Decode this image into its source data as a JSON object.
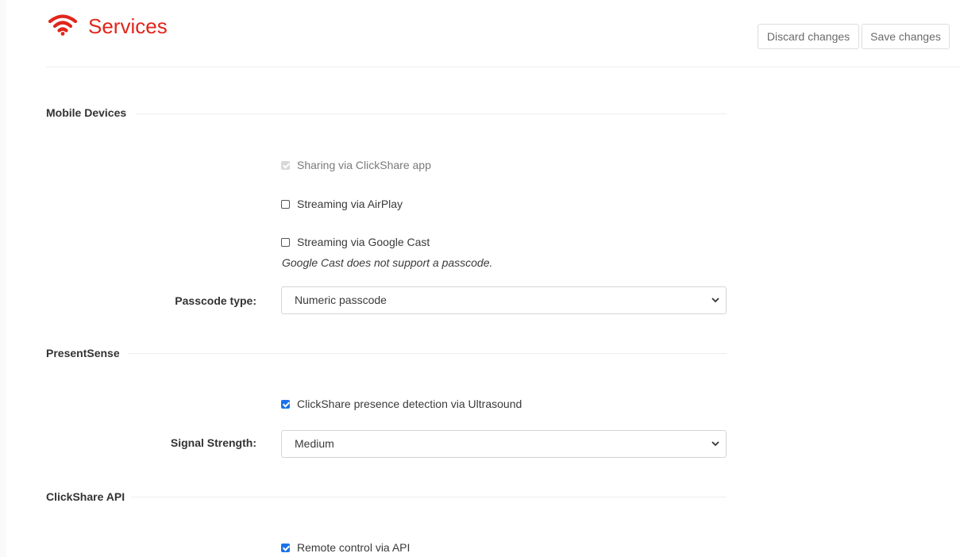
{
  "header": {
    "title": "Services",
    "discard_label": "Discard changes",
    "save_label": "Save changes",
    "accent_color": "#e1251b",
    "icon": "wifi-icon"
  },
  "sections": {
    "mobile": {
      "title": "Mobile Devices",
      "clickshare_app": {
        "label": "Sharing via ClickShare app",
        "checked": true,
        "disabled": true
      },
      "airplay": {
        "label": "Streaming via AirPlay",
        "checked": false
      },
      "google_cast": {
        "label": "Streaming via Google Cast",
        "checked": false,
        "note": "Google Cast does not support a passcode."
      },
      "passcode": {
        "label": "Passcode type:",
        "value": "Numeric passcode"
      }
    },
    "presentsense": {
      "title": "PresentSense",
      "ultrasound": {
        "label": "ClickShare presence detection via Ultrasound",
        "checked": true
      },
      "signal": {
        "label": "Signal Strength:",
        "value": "Medium"
      }
    },
    "api": {
      "title": "ClickShare API",
      "remote": {
        "label": "Remote control via API",
        "checked": true
      }
    }
  }
}
